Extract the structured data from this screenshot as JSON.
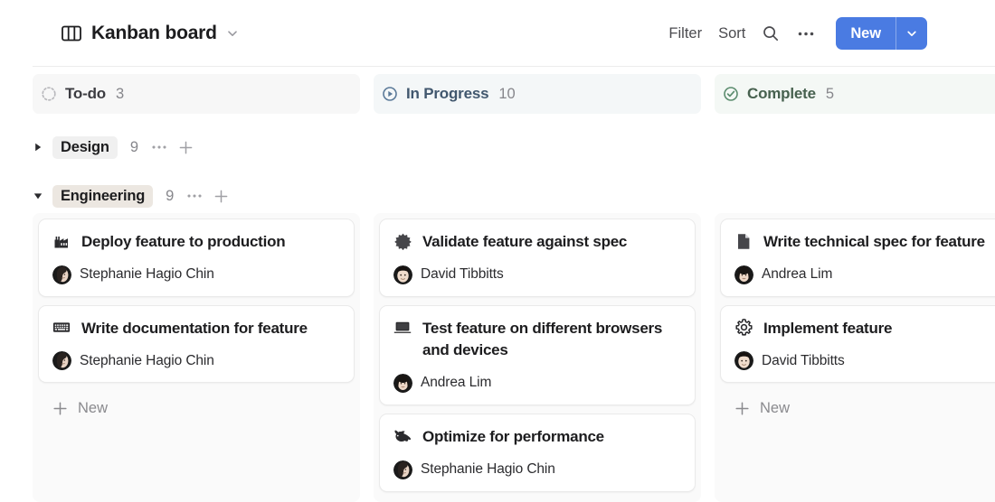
{
  "header": {
    "board_icon": "kanban-board-icon",
    "title": "Kanban board",
    "title_caret": "chevron-down-icon",
    "filter_label": "Filter",
    "sort_label": "Sort",
    "search_icon": "search-icon",
    "more_icon": "ellipsis-icon",
    "new_label": "New",
    "new_caret": "chevron-down-icon",
    "new_button_color": "#4a7be2"
  },
  "columns": [
    {
      "id": "todo",
      "name": "To-do",
      "count": "3",
      "icon": "dashed-circle-icon",
      "icon_color": "#b9b9bd",
      "name_color": "#3c3c41",
      "head_bg": "#f7f7f7",
      "show_new": true,
      "new_label": "New",
      "cards": [
        {
          "emoji": "factory-icon",
          "title": "Deploy feature to production",
          "assignee": "Stephanie Hagio Chin",
          "avatar": "stephanie-avatar",
          "wrap": false
        },
        {
          "emoji": "keyboard-icon",
          "title": "Write documentation for feature",
          "assignee": "Stephanie Hagio Chin",
          "avatar": "stephanie-avatar",
          "wrap": false
        }
      ]
    },
    {
      "id": "in-progress",
      "name": "In Progress",
      "count": "10",
      "icon": "play-circle-icon",
      "icon_color": "#5b7a99",
      "name_color": "#41576e",
      "head_bg": "#f4f7f8",
      "show_new": false,
      "new_label": "New",
      "cards": [
        {
          "emoji": "starburst-icon",
          "title": "Validate feature against spec",
          "assignee": "David Tibbitts",
          "avatar": "david-avatar",
          "wrap": false
        },
        {
          "emoji": "laptop-icon",
          "title": "Test feature on different browsers and devices",
          "assignee": "Andrea Lim",
          "avatar": "andrea-avatar",
          "wrap": true
        },
        {
          "emoji": "rabbit-icon",
          "title": "Optimize for performance",
          "assignee": "Stephanie Hagio Chin",
          "avatar": "stephanie-avatar",
          "wrap": false
        }
      ]
    },
    {
      "id": "complete",
      "name": "Complete",
      "count": "5",
      "icon": "check-circle-icon",
      "icon_color": "#5b8c6e",
      "name_color": "#47614f",
      "head_bg": "#f4f8f5",
      "show_new": true,
      "new_label": "New",
      "cards": [
        {
          "emoji": "document-icon",
          "title": "Write technical spec for feature",
          "assignee": "Andrea Lim",
          "avatar": "andrea-avatar",
          "wrap": false
        },
        {
          "emoji": "gear-icon",
          "title": "Implement feature",
          "assignee": "David Tibbitts",
          "avatar": "david-avatar",
          "wrap": false
        }
      ]
    }
  ],
  "groups": [
    {
      "name": "Design",
      "count": "9",
      "expanded": false,
      "triangle": "triangle-right-icon",
      "pill_bg": "#f0f0f0",
      "more_icon": "ellipsis-icon",
      "add_icon": "plus-icon"
    },
    {
      "name": "Engineering",
      "count": "9",
      "expanded": true,
      "triangle": "triangle-down-icon",
      "pill_bg": "#ece7e1",
      "more_icon": "ellipsis-icon",
      "add_icon": "plus-icon"
    }
  ]
}
